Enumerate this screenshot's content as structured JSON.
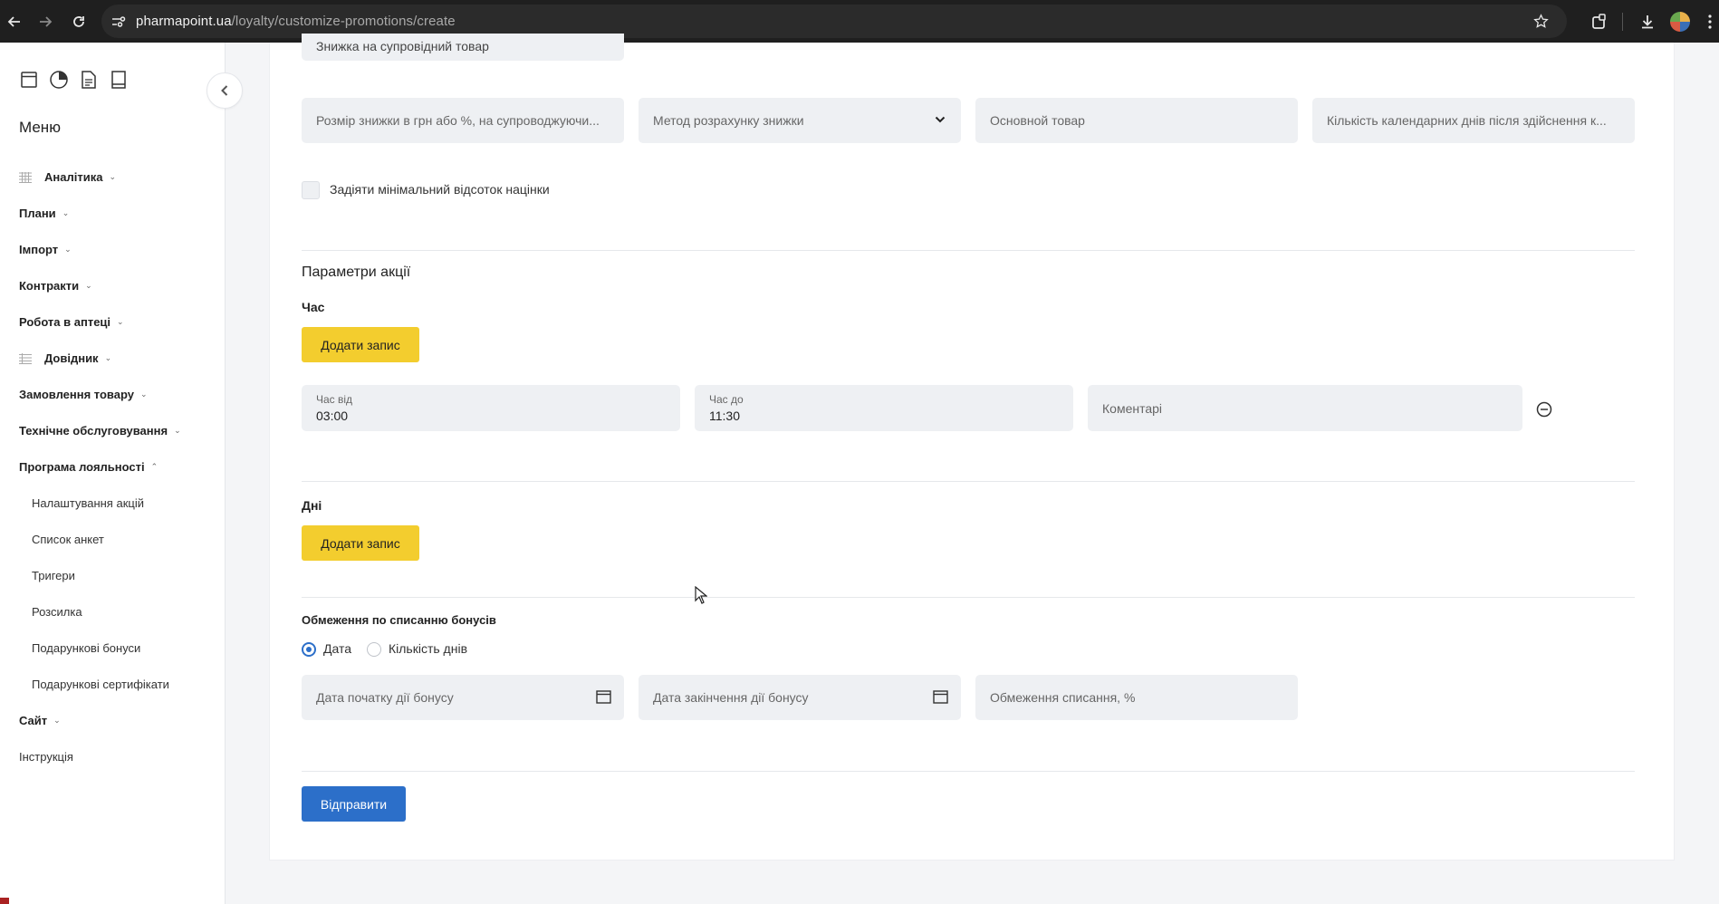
{
  "browser": {
    "url_host": "pharmapoint.ua",
    "url_path": "/loyalty/customize-promotions/create",
    "icons": [
      "back-icon",
      "forward-icon",
      "reload-icon",
      "site-settings-icon",
      "star-icon",
      "extensions-icon",
      "download-icon",
      "profile-avatar",
      "more-icon"
    ]
  },
  "sidebar": {
    "menu_title": "Меню",
    "items": [
      {
        "label": "Аналітика",
        "chevron": "⌄"
      },
      {
        "label": "Плани",
        "chevron": "⌄"
      },
      {
        "label": "Імпорт",
        "chevron": "⌄"
      },
      {
        "label": "Контракти",
        "chevron": "⌄"
      },
      {
        "label": "Робота в аптеці",
        "chevron": "⌄"
      },
      {
        "label": "Довідник",
        "chevron": "⌄"
      },
      {
        "label": "Замовлення товару",
        "chevron": "⌄"
      },
      {
        "label": "Технічне обслуговування",
        "chevron": "⌄"
      },
      {
        "label": "Програма лояльності",
        "chevron": "⌃"
      }
    ],
    "loyalty_sub": [
      "Налаштування акцій",
      "Список анкет",
      "Тригери",
      "Розсилка",
      "Подарункові бонуси",
      "Подарункові сертифікати"
    ],
    "site": {
      "label": "Сайт",
      "chevron": "⌄"
    },
    "instruction": "Інструкція"
  },
  "form": {
    "top_field": "Знижка на супровідний товар",
    "row1": {
      "discount_size": "Розмір знижки в грн або %, на супроводжуючи...",
      "calc_method": "Метод розрахунку знижки",
      "main_product": "Основной товар",
      "calendar_days": "Кількість календарних днів після здійснення к..."
    },
    "min_markup_label": "Задіяти мінімальний відсоток націнки",
    "params_title": "Параметри акції",
    "time": {
      "label": "Час",
      "add_button": "Додати запис",
      "from_label": "Час від",
      "from_value": "03:00",
      "to_label": "Час до",
      "to_value": "11:30",
      "comments": "Коментарі"
    },
    "days": {
      "label": "Дні",
      "add_button": "Додати запис"
    },
    "bonus_limits": {
      "label": "Обмеження по списанню бонусів",
      "radio_date": "Дата",
      "radio_days": "Кількість днів",
      "selected": "Дата",
      "start_date": "Дата початку дії бонусу",
      "end_date": "Дата закінчення дії бонусу",
      "limit_percent": "Обмеження списання, %"
    },
    "submit": "Відправити"
  }
}
